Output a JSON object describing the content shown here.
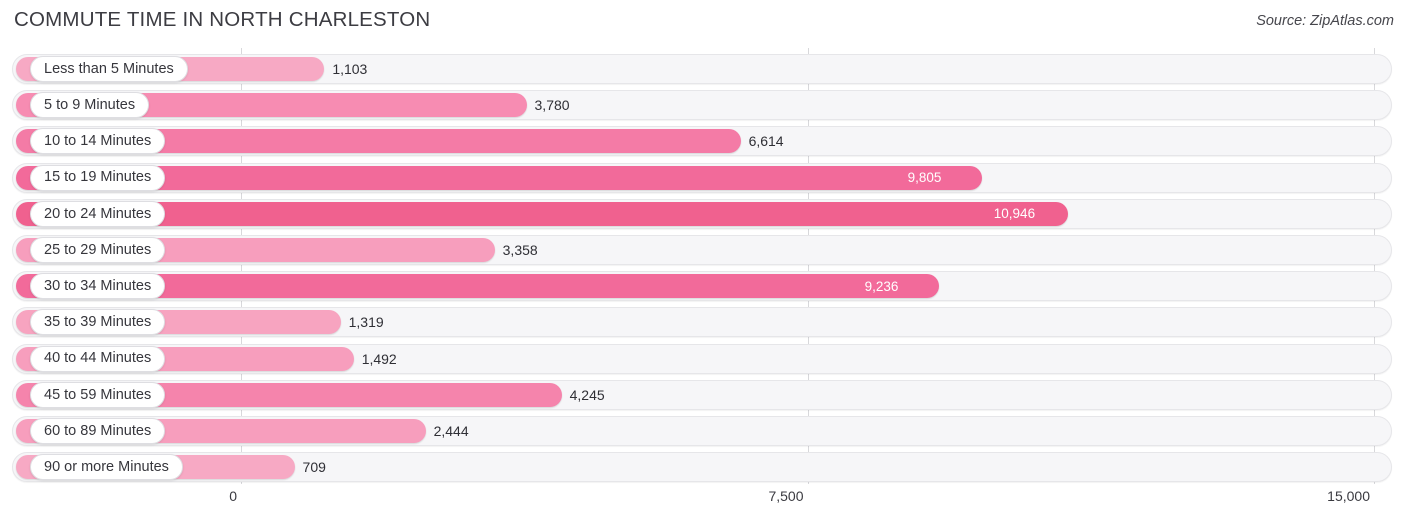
{
  "header": {
    "title": "COMMUTE TIME IN NORTH CHARLESTON",
    "source": "Source: ZipAtlas.com"
  },
  "colors": {
    "bar_light": "#f7a9c4",
    "bar_medium": "#f78cb2",
    "bar_strong": "#f26a9a",
    "track": "#f6f6f8",
    "gridline": "#d8d8db",
    "title_text": "#3c3c42",
    "value_text": "#2f2f35",
    "value_text_inside": "#ffffff"
  },
  "chart_data": {
    "type": "bar",
    "orientation": "horizontal",
    "title": "COMMUTE TIME IN NORTH CHARLESTON",
    "xlabel": "",
    "ylabel": "",
    "xlim": [
      0,
      15000
    ],
    "grid": true,
    "legend": false,
    "axis_ticks": [
      "0",
      "7,500",
      "15,000"
    ],
    "axis_tick_values": [
      0,
      7500,
      15000
    ],
    "categories": [
      "Less than 5 Minutes",
      "5 to 9 Minutes",
      "10 to 14 Minutes",
      "15 to 19 Minutes",
      "20 to 24 Minutes",
      "25 to 29 Minutes",
      "30 to 34 Minutes",
      "35 to 39 Minutes",
      "40 to 44 Minutes",
      "45 to 59 Minutes",
      "60 to 89 Minutes",
      "90 or more Minutes"
    ],
    "values": [
      1103,
      3780,
      6614,
      9805,
      10946,
      3358,
      9236,
      1319,
      1492,
      4245,
      2444,
      709
    ],
    "value_labels": [
      "1,103",
      "3,780",
      "6,614",
      "9,805",
      "10,946",
      "3,358",
      "9,236",
      "1,319",
      "1,492",
      "4,245",
      "2,444",
      "709"
    ],
    "bars": [
      {
        "label": "Less than 5 Minutes",
        "value": 1103,
        "value_label": "1,103",
        "color": "#f7a9c4",
        "label_inside": false
      },
      {
        "label": "5 to 9 Minutes",
        "value": 3780,
        "value_label": "3,780",
        "color": "#f78cb2",
        "label_inside": false
      },
      {
        "label": "10 to 14 Minutes",
        "value": 6614,
        "value_label": "6,614",
        "color": "#f47ba6",
        "label_inside": false
      },
      {
        "label": "15 to 19 Minutes",
        "value": 9805,
        "value_label": "9,805",
        "color": "#f26a9a",
        "label_inside": true
      },
      {
        "label": "20 to 24 Minutes",
        "value": 10946,
        "value_label": "10,946",
        "color": "#f0618f",
        "label_inside": true
      },
      {
        "label": "25 to 29 Minutes",
        "value": 3358,
        "value_label": "3,358",
        "color": "#f79ebd",
        "label_inside": false
      },
      {
        "label": "30 to 34 Minutes",
        "value": 9236,
        "value_label": "9,236",
        "color": "#f26a9a",
        "label_inside": true
      },
      {
        "label": "35 to 39 Minutes",
        "value": 1319,
        "value_label": "1,319",
        "color": "#f7a4c0",
        "label_inside": false
      },
      {
        "label": "40 to 44 Minutes",
        "value": 1492,
        "value_label": "1,492",
        "color": "#f79ebd",
        "label_inside": false
      },
      {
        "label": "45 to 59 Minutes",
        "value": 4245,
        "value_label": "4,245",
        "color": "#f584ac",
        "label_inside": false
      },
      {
        "label": "60 to 89 Minutes",
        "value": 2444,
        "value_label": "2,444",
        "color": "#f79ebd",
        "label_inside": false
      },
      {
        "label": "90 or more Minutes",
        "value": 709,
        "value_label": "709",
        "color": "#f7a9c4",
        "label_inside": false
      }
    ]
  }
}
